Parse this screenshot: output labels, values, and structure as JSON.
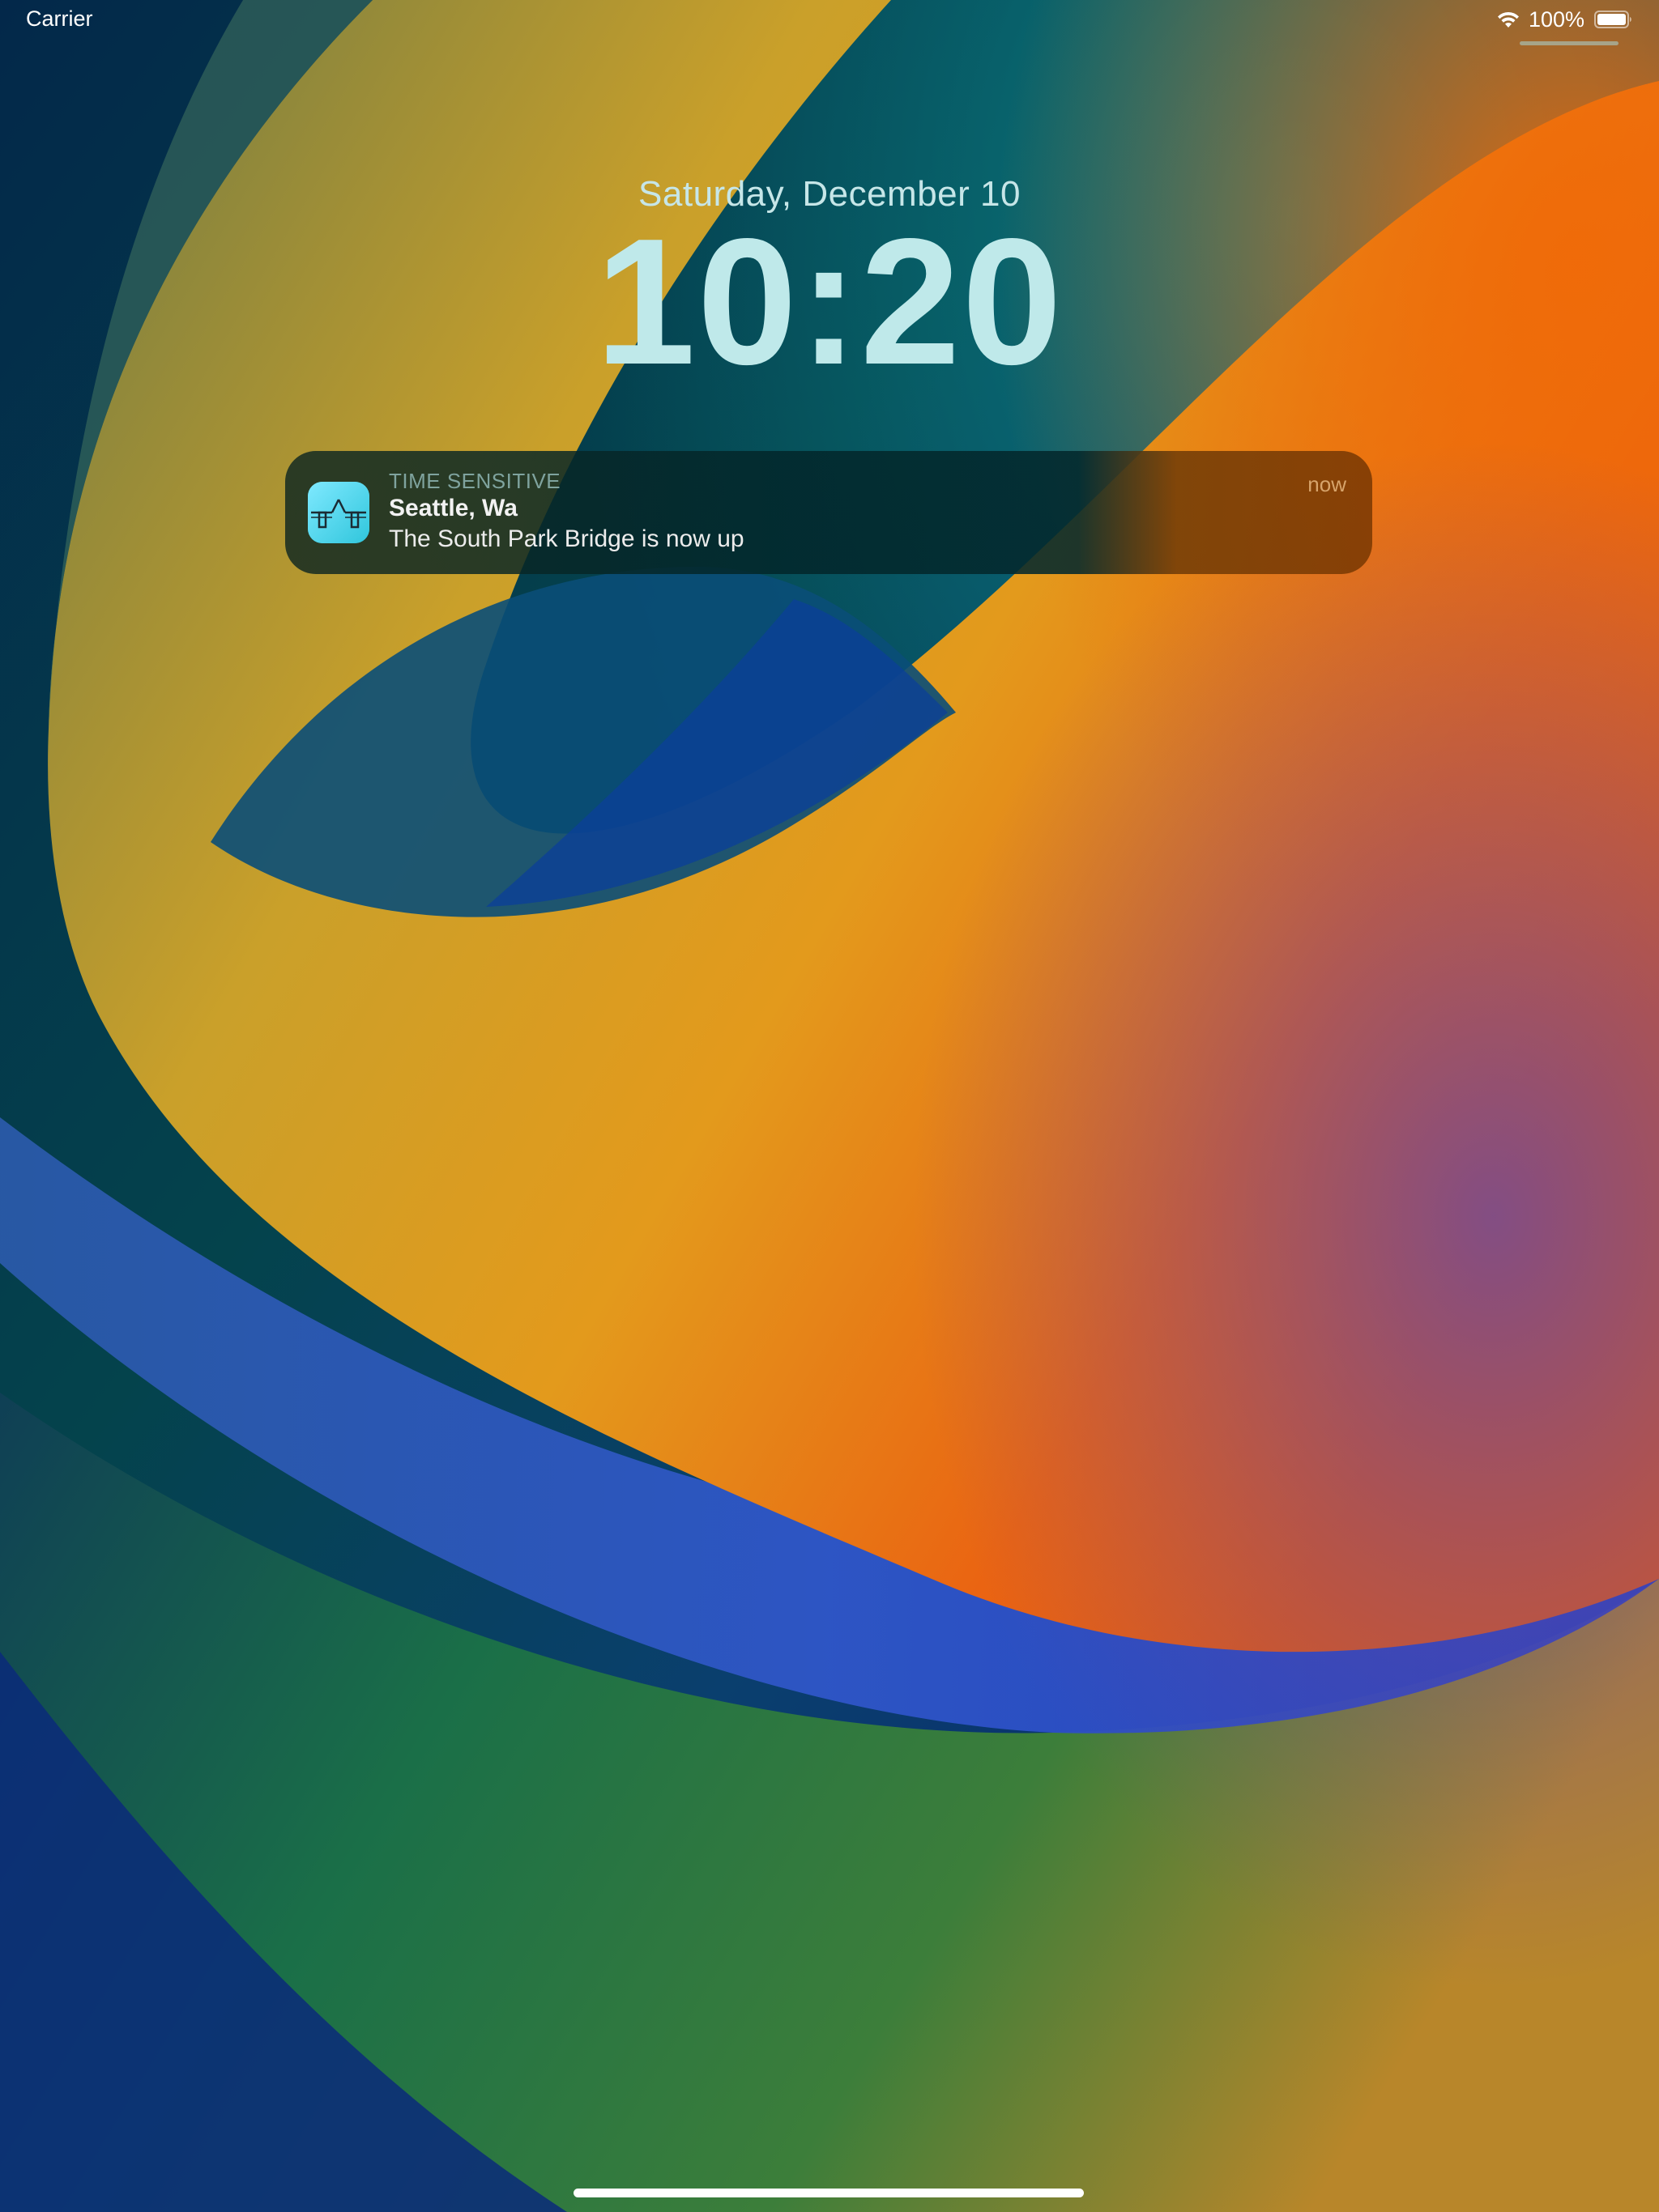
{
  "status_bar": {
    "carrier": "Carrier",
    "battery_percent": "100%",
    "wifi_icon": "wifi-icon",
    "battery_icon": "battery-full-icon"
  },
  "lock_screen": {
    "date": "Saturday, December 10",
    "time": "10:20"
  },
  "notification": {
    "app_icon": "bridge-icon",
    "category": "TIME SENSITIVE",
    "title": "Seattle, Wa",
    "body": "The South Park Bridge is now up",
    "timestamp": "now"
  },
  "colors": {
    "time_text": "#bfe9ea",
    "date_text": "#c6e6e8",
    "notification_timestamp": "#d7a46b",
    "app_icon_accent": "#3ad0e6"
  }
}
